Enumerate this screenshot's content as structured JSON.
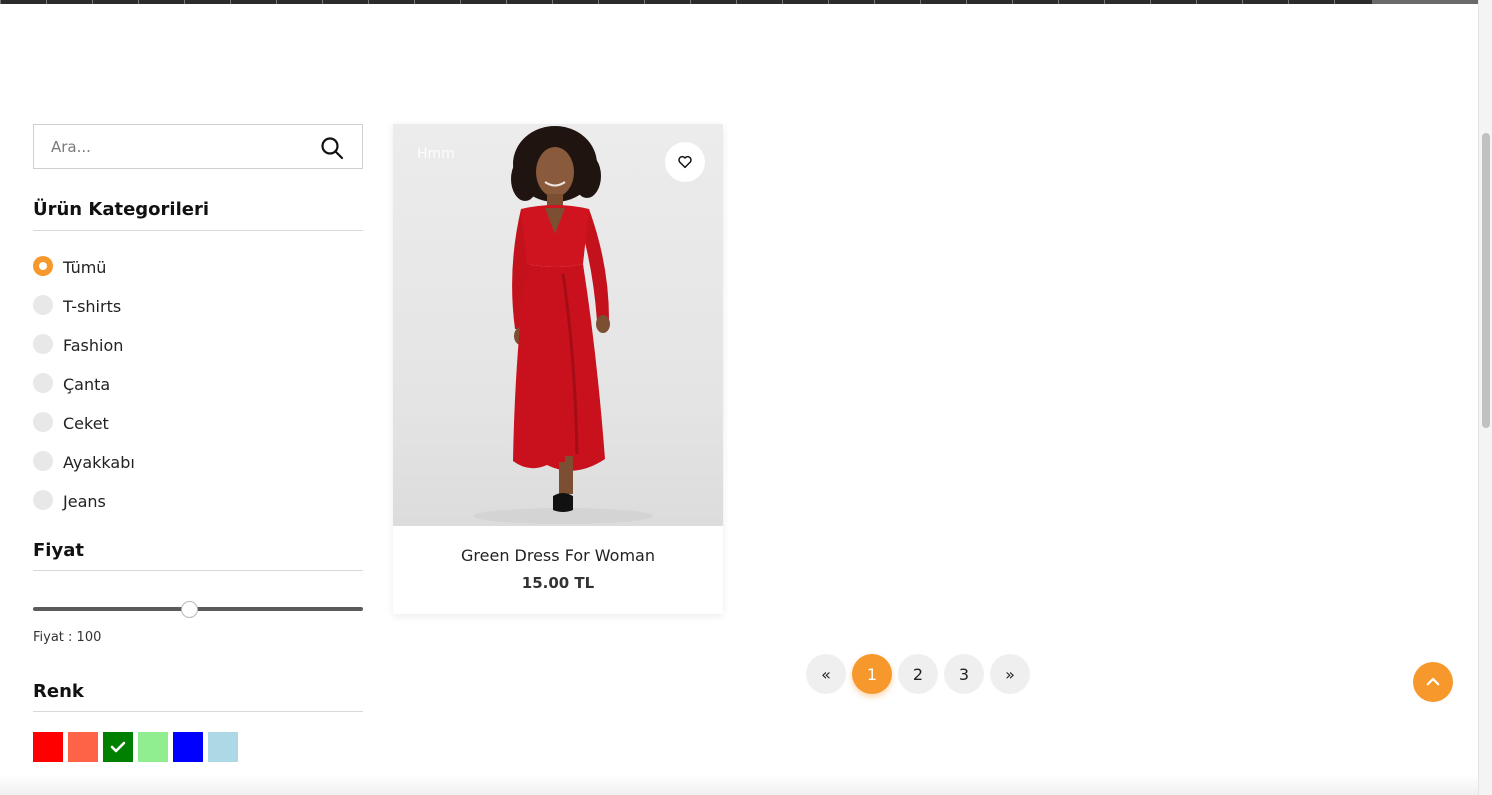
{
  "search": {
    "placeholder": "Ara...",
    "icon": "search-icon"
  },
  "categories": {
    "title": "Ürün Kategorileri",
    "items": [
      {
        "label": "Tümü",
        "selected": true
      },
      {
        "label": "T-shirts",
        "selected": false
      },
      {
        "label": "Fashion",
        "selected": false
      },
      {
        "label": "Çanta",
        "selected": false
      },
      {
        "label": "Ceket",
        "selected": false
      },
      {
        "label": "Ayakkabı",
        "selected": false
      },
      {
        "label": "Jeans",
        "selected": false
      }
    ]
  },
  "price": {
    "title": "Fiyat",
    "label": "Fiyat : 100",
    "value": 100
  },
  "color": {
    "title": "Renk",
    "swatches": [
      {
        "color": "#ff0000",
        "selected": false
      },
      {
        "color": "#ff6347",
        "selected": false
      },
      {
        "color": "#008000",
        "selected": true
      },
      {
        "color": "#90ee90",
        "selected": false
      },
      {
        "color": "#0000ff",
        "selected": false
      },
      {
        "color": "#add8e6",
        "selected": false
      }
    ]
  },
  "product": {
    "badge": "Hmm",
    "name": "Green Dress For Woman",
    "price": "15.00 TL",
    "favorite_icon": "heart-icon"
  },
  "pagination": {
    "prev": "«",
    "pages": [
      "1",
      "2",
      "3"
    ],
    "active": "1",
    "next": "»"
  },
  "scroll_top_icon": "chevron-up-icon",
  "accent_color": "#f7982d"
}
